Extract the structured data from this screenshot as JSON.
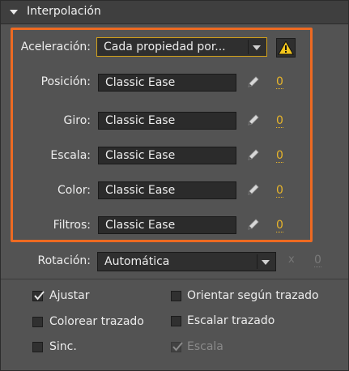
{
  "panel": {
    "title": "Interpolación"
  },
  "easing": {
    "label": "Aceleración:",
    "value": "Cada propiedad por..."
  },
  "properties": [
    {
      "label": "Posición:",
      "value": "Classic Ease",
      "amount": "0"
    },
    {
      "label": "Giro:",
      "value": "Classic Ease",
      "amount": "0"
    },
    {
      "label": "Escala:",
      "value": "Classic Ease",
      "amount": "0"
    },
    {
      "label": "Color:",
      "value": "Classic Ease",
      "amount": "0"
    },
    {
      "label": "Filtros:",
      "value": "Classic Ease",
      "amount": "0"
    }
  ],
  "rotation": {
    "label": "Rotación:",
    "value": "Automática",
    "times": "x",
    "count": "0"
  },
  "options": {
    "snap": {
      "label": "Ajustar",
      "checked": true
    },
    "orient_to_path": {
      "label": "Orientar según trazado",
      "checked": false
    },
    "color_along_path": {
      "label": "Colorear trazado",
      "checked": false
    },
    "scale_along_path": {
      "label": "Escalar trazado",
      "checked": false
    },
    "sync": {
      "label": "Sinc.",
      "checked": false
    },
    "scale": {
      "label": "Escala",
      "checked": true,
      "disabled": true
    }
  },
  "colors": {
    "highlight": "#ee6a22",
    "value_link": "#e8b52a",
    "warning": "#f2c51c"
  }
}
